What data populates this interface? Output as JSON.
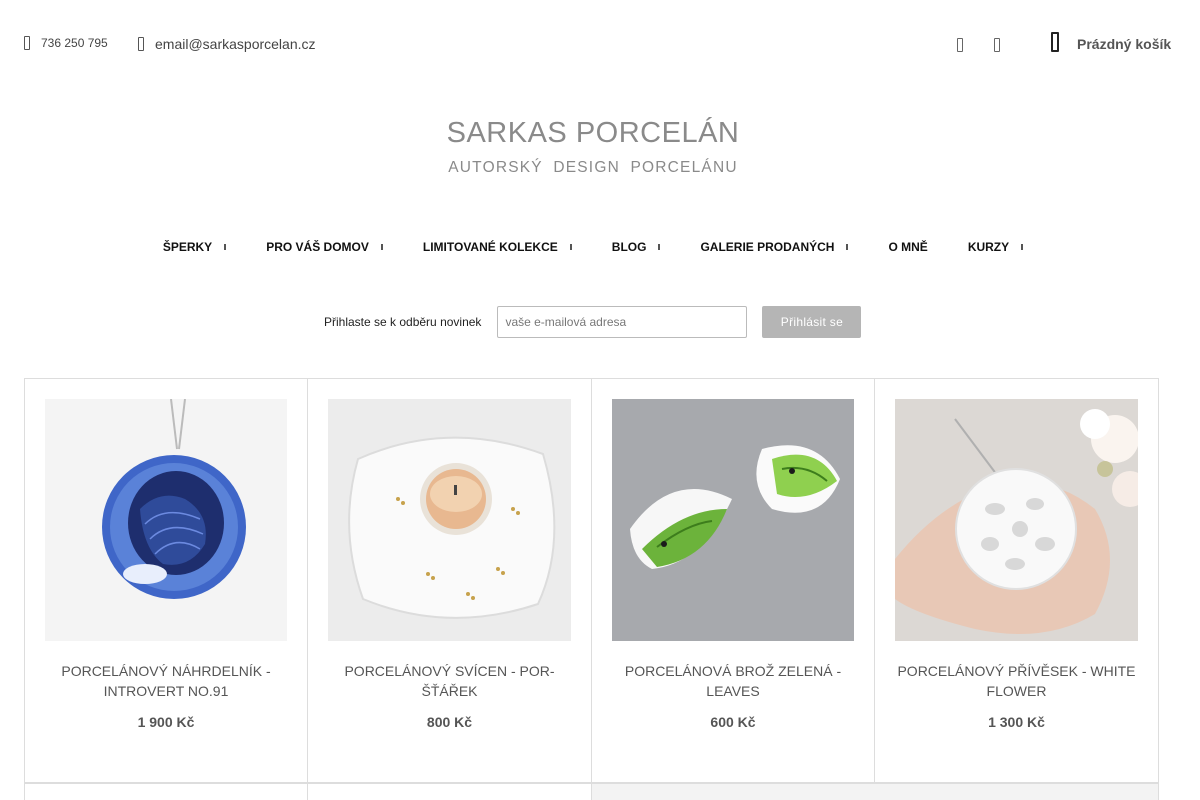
{
  "header": {
    "phone": "736 250 795",
    "email": "email@sarkasporcelan.cz",
    "cart_label": "Prázdný košík",
    "icons": [
      "phone-icon",
      "email-icon",
      "user-icon",
      "heart-icon",
      "cart-icon"
    ]
  },
  "logo": {
    "title": "SARKAS PORCELÁN",
    "subtitle": "AUTORSKÝ DESIGN PORCELÁNU"
  },
  "nav": {
    "items": [
      {
        "label": "ŠPERKY",
        "has_dropdown": true
      },
      {
        "label": "PRO VÁŠ DOMOV",
        "has_dropdown": true
      },
      {
        "label": "LIMITOVANÉ KOLEKCE",
        "has_dropdown": true
      },
      {
        "label": "BLOG",
        "has_dropdown": true
      },
      {
        "label": "GALERIE PRODANÝCH",
        "has_dropdown": true
      },
      {
        "label": "O MNĚ",
        "has_dropdown": false
      },
      {
        "label": "KURZY",
        "has_dropdown": true
      }
    ]
  },
  "newsletter": {
    "label": "Přihlaste se k odběru novinek",
    "placeholder": "vaše e-mailová adresa",
    "button": "Přihlásit se"
  },
  "products": [
    {
      "name": "PORCELÁNOVÝ NÁHRDELNÍK - INTROVERT NO.91",
      "price": "1 900 Kč"
    },
    {
      "name": "PORCELÁNOVÝ SVÍCEN - POR-ŠŤÁŘEK",
      "price": "800 Kč"
    },
    {
      "name": "PORCELÁNOVÁ BROŽ ZELENÁ - LEAVES",
      "price": "600 Kč"
    },
    {
      "name": "PORCELÁNOVÝ PŘÍVĚSEK - WHITE FLOWER",
      "price": "1 300 Kč"
    }
  ],
  "colors": {
    "text": "#333333",
    "logo": "#8a8a8a",
    "button_bg": "#b5b5b5",
    "border": "#dddddd"
  }
}
